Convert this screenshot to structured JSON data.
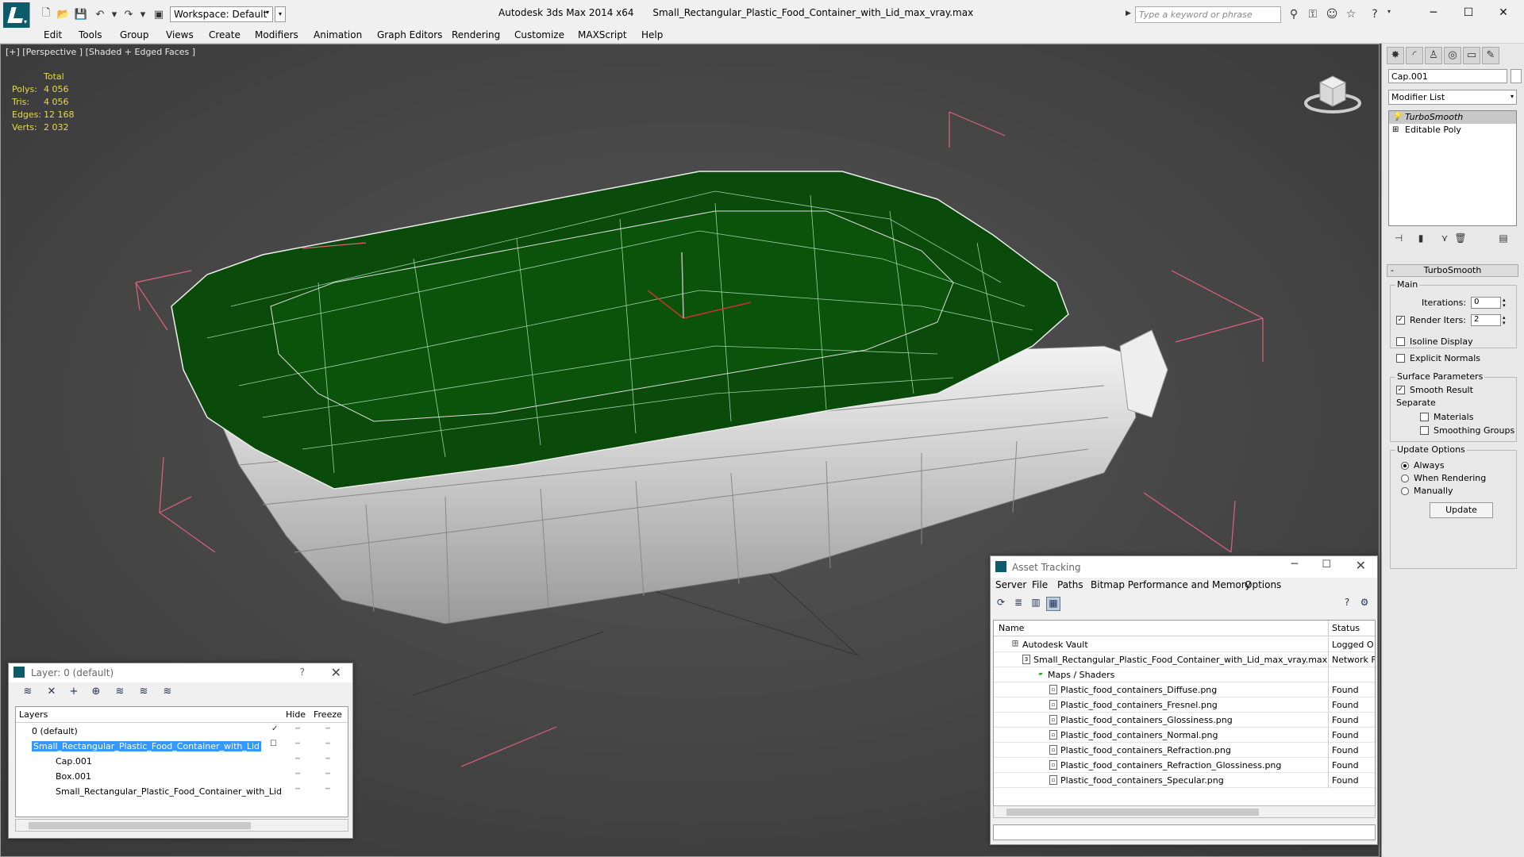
{
  "titlebar": {
    "workspace": "Workspace: Default",
    "app_version": "Autodesk 3ds Max  2014 x64",
    "filename": "Small_Rectangular_Plastic_Food_Container_with_Lid_max_vray.max",
    "search_placeholder": "Type a keyword or phrase"
  },
  "menu": [
    "Edit",
    "Tools",
    "Group",
    "Views",
    "Create",
    "Modifiers",
    "Animation",
    "Graph Editors",
    "Rendering",
    "Customize",
    "MAXScript",
    "Help"
  ],
  "viewport": {
    "label": "[+] [Perspective ] [Shaded + Edged Faces ]",
    "stats": {
      "header": "Total",
      "polys_label": "Polys:",
      "polys": "4 056",
      "tris_label": "Tris:",
      "tris": "4 056",
      "edges_label": "Edges:",
      "edges": "12 168",
      "verts_label": "Verts:",
      "verts": "2 032"
    }
  },
  "command_panel": {
    "object_name": "Cap.001",
    "modifier_list": "Modifier List",
    "stack": [
      "TurboSmooth",
      "Editable Poly"
    ],
    "rollout": "TurboSmooth",
    "main_group": "Main",
    "iterations_label": "Iterations:",
    "iterations": "0",
    "render_iters_label": "Render Iters:",
    "render_iters": "2",
    "isoline": "Isoline Display",
    "explicit_normals": "Explicit Normals",
    "surface_group": "Surface Parameters",
    "smooth_result": "Smooth Result",
    "separate": "Separate",
    "materials": "Materials",
    "smoothing_groups": "Smoothing Groups",
    "update_group": "Update Options",
    "always": "Always",
    "when_rendering": "When Rendering",
    "manually": "Manually",
    "update_btn": "Update"
  },
  "layer_dialog": {
    "title": "Layer: 0 (default)",
    "help": "?",
    "col_layers": "Layers",
    "col_hide": "Hide",
    "col_freeze": "Freeze",
    "rows": [
      {
        "name": "0 (default)"
      },
      {
        "name": "Small_Rectangular_Plastic_Food_Container_with_Lid"
      },
      {
        "name": "Cap.001"
      },
      {
        "name": "Box.001"
      },
      {
        "name": "Small_Rectangular_Plastic_Food_Container_with_Lid"
      }
    ]
  },
  "asset_dialog": {
    "title": "Asset Tracking",
    "menu": [
      "Server",
      "File",
      "Paths",
      "Bitmap Performance and Memory",
      "Options"
    ],
    "col_name": "Name",
    "col_status": "Status",
    "rows": [
      {
        "name": "Autodesk Vault",
        "status": "Logged O"
      },
      {
        "name": "Small_Rectangular_Plastic_Food_Container_with_Lid_max_vray.max",
        "status": "Network F"
      },
      {
        "name": "Maps / Shaders",
        "status": ""
      },
      {
        "name": "Plastic_food_containers_Diffuse.png",
        "status": "Found"
      },
      {
        "name": "Plastic_food_containers_Fresnel.png",
        "status": "Found"
      },
      {
        "name": "Plastic_food_containers_Glossiness.png",
        "status": "Found"
      },
      {
        "name": "Plastic_food_containers_Normal.png",
        "status": "Found"
      },
      {
        "name": "Plastic_food_containers_Refraction.png",
        "status": "Found"
      },
      {
        "name": "Plastic_food_containers_Refraction_Glossiness.png",
        "status": "Found"
      },
      {
        "name": "Plastic_food_containers_Specular.png",
        "status": "Found"
      }
    ]
  },
  "colors": {
    "lid": "#0a4a0a",
    "body": "#d8d8d8",
    "bbox": "#e06080",
    "stats": "#e8d84a"
  }
}
